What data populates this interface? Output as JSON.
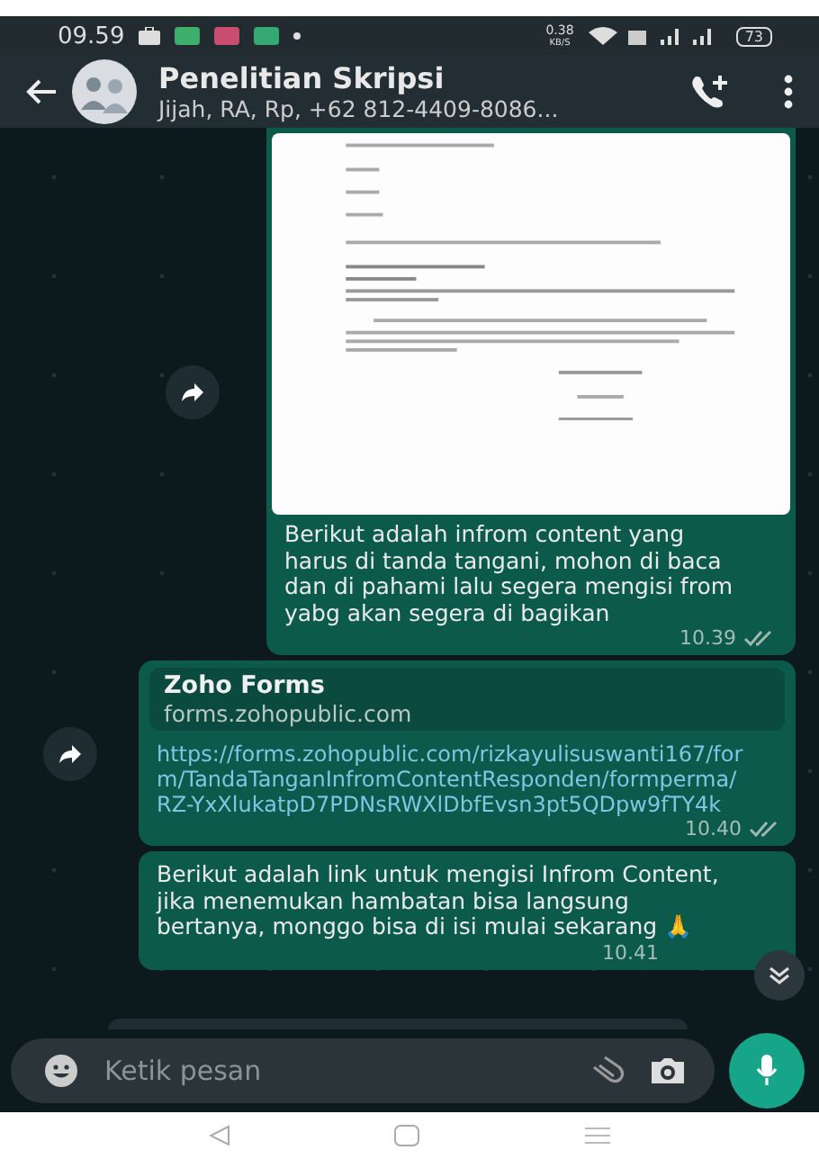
{
  "status_bar": {
    "time": "09.59",
    "net_speed": "0.38",
    "net_unit": "KB/S",
    "battery": "73"
  },
  "header": {
    "title": "Penelitian Skripsi",
    "subtitle": "Jijah, RA, Rp, +62 812-4409-8086..."
  },
  "messages": [
    {
      "caption": "Berikut adalah infrom content yang harus di tanda tangani, mohon di baca dan di pahami lalu segera mengisi from yabg akan segera di bagikan",
      "time": "10.39",
      "read": true,
      "forwardable": true
    },
    {
      "kind": "link",
      "preview_title": "Zoho Forms",
      "preview_domain": "forms.zohopublic.com",
      "url": "https://forms.zohopublic.com/rizkayulisuswanti167/form/TandaTanganInfromContentResponden/formperma/RZ-YxXlukatpD7PDNsRWXlDbfEvsn3pt5QDpw9fTY4k",
      "time": "10.40",
      "read": true,
      "forwardable": true
    },
    {
      "kind": "text",
      "text": "Berikut adalah link untuk mengisi Infrom Content, jika menemukan hambatan bisa langsung bertanya, monggo bisa di isi mulai sekarang 🙏",
      "time": "10.41",
      "read": false,
      "forwardable": false
    }
  ],
  "composer": {
    "placeholder": "Ketik pesan"
  }
}
